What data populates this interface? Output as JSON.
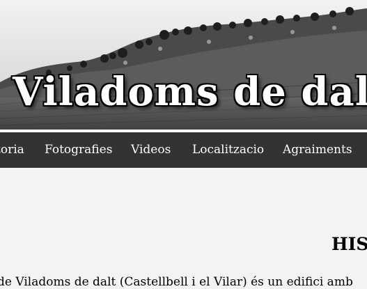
{
  "header": {
    "site_title": "Viladoms de dalt"
  },
  "nav": {
    "items": [
      {
        "label": "toria"
      },
      {
        "label": "Fotografies"
      },
      {
        "label": "Videos"
      },
      {
        "label": "Localitzacio"
      },
      {
        "label": "Agraiments"
      }
    ]
  },
  "main": {
    "heading": "HIS",
    "intro": "de Viladoms de dalt (Castellbell i el Vilar) és un edifici amb"
  }
}
